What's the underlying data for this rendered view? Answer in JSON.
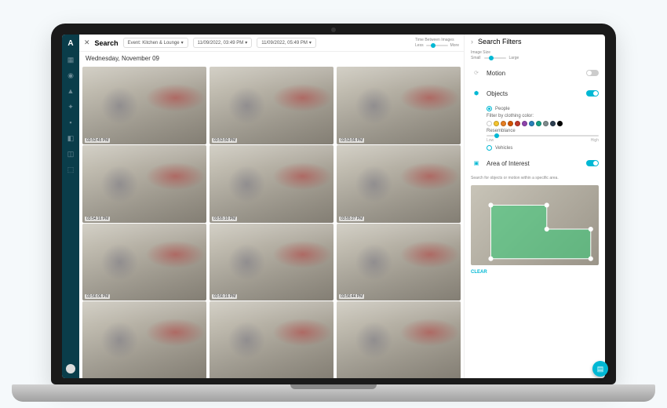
{
  "app": {
    "logo": "A"
  },
  "sidebar": {
    "items": [
      "dashboard",
      "camera",
      "alert",
      "settings",
      "users",
      "devices",
      "layout",
      "integrations"
    ]
  },
  "topbar": {
    "title": "Search",
    "camera_label": "Event: Kitchen & Lounge",
    "date_from": "11/09/2022, 03:49 PM",
    "date_to": "11/09/2022, 05:49 PM",
    "time_between_label": "Time Between Images",
    "time_between_low": "Less",
    "time_between_high": "More"
  },
  "date_header": "Wednesday, November 09",
  "thumbnails": [
    {
      "ts": "03:53:45 PM"
    },
    {
      "ts": "03:53:50 PM"
    },
    {
      "ts": "03:53:56 PM"
    },
    {
      "ts": "03:54:16 PM"
    },
    {
      "ts": "03:55:10 PM"
    },
    {
      "ts": "03:55:27 PM"
    },
    {
      "ts": "03:56:06 PM"
    },
    {
      "ts": "03:56:16 PM"
    },
    {
      "ts": "03:56:44 PM"
    },
    {
      "ts": "",
      "partial": true
    },
    {
      "ts": "",
      "partial": true
    },
    {
      "ts": "",
      "partial": true
    }
  ],
  "filters": {
    "header": "Search Filters",
    "image_size": {
      "label": "Image Size",
      "low": "Small",
      "high": "Large"
    },
    "motion": {
      "label": "Motion",
      "enabled": false
    },
    "objects": {
      "label": "Objects",
      "enabled": true,
      "people": {
        "label": "People",
        "selected": true
      },
      "clothing_label": "Filter by clothing color:",
      "colors": [
        "#ffffff",
        "#f4c430",
        "#e67e22",
        "#d35400",
        "#c0392b",
        "#8e44ad",
        "#2980b9",
        "#16a085",
        "#7f8c8d",
        "#2c3e50",
        "#000000"
      ],
      "resemblance": {
        "label": "Resemblance",
        "low": "Low",
        "high": "High"
      },
      "vehicles": {
        "label": "Vehicles",
        "selected": false
      }
    },
    "aoi": {
      "label": "Area of Interest",
      "enabled": true,
      "desc": "Search for objects or motion within a specific area.",
      "clear": "CLEAR"
    }
  }
}
